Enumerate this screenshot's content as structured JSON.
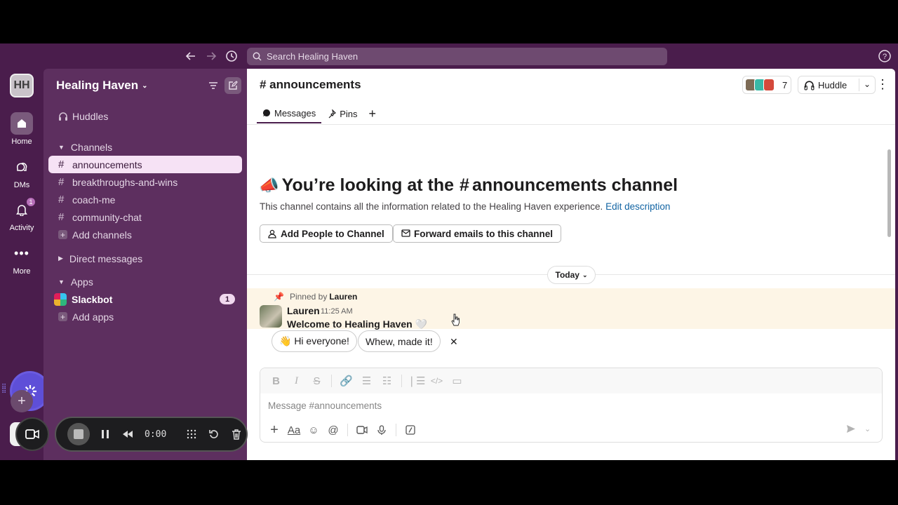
{
  "search": {
    "placeholder": "Search Healing Haven"
  },
  "workspace": {
    "initials": "HH",
    "name": "Healing Haven"
  },
  "rail": {
    "items": [
      {
        "label": "Home"
      },
      {
        "label": "DMs"
      },
      {
        "label": "Activity",
        "badge": "1"
      },
      {
        "label": "More"
      }
    ]
  },
  "sidebar": {
    "huddles": "Huddles",
    "channels_header": "Channels",
    "channels": [
      "announcements",
      "breakthroughs-and-wins",
      "coach-me",
      "community-chat"
    ],
    "add_channels": "Add channels",
    "direct_messages": "Direct messages",
    "apps_header": "Apps",
    "slackbot": "Slackbot",
    "slackbot_badge": "1",
    "add_apps": "Add apps"
  },
  "recorder": {
    "time": "0:00"
  },
  "channel": {
    "title": "# announcements",
    "member_count": "7",
    "huddle_label": "Huddle",
    "tabs": [
      "Messages",
      "Pins"
    ]
  },
  "intro": {
    "title_pre": "You’re looking at the",
    "title_channel": "announcements channel",
    "description": "This channel contains all the information related to the Healing Haven experience.",
    "edit_link": "Edit description",
    "add_people": "Add People to Channel",
    "forward_emails": "Forward emails to this channel"
  },
  "divider": {
    "label": "Today"
  },
  "message": {
    "pinned_prefix": "Pinned by",
    "pinned_by": "Lauren",
    "author": "Lauren",
    "time": "11:25 AM",
    "text": "Welcome to Healing Haven 🤍"
  },
  "suggestions": [
    "👋 Hi everyone!",
    "Whew, made it!"
  ],
  "composer": {
    "placeholder": "Message #announcements"
  },
  "colors": {
    "aubergine": "#4a1d4c",
    "sidebar": "#5d2f5f",
    "link": "#1264a3",
    "pinned_bg": "#fdf5e6"
  }
}
